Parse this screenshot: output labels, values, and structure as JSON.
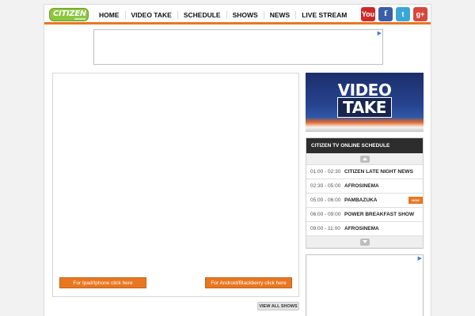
{
  "logo": {
    "text": "CITIZEN"
  },
  "nav": [
    "HOME",
    "VIDEO TAKE",
    "SCHEDULE",
    "SHOWS",
    "NEWS",
    "LIVE STREAM"
  ],
  "social": [
    {
      "name": "youtube-icon",
      "label": "You",
      "color": "#cc2a2a"
    },
    {
      "name": "facebook-icon",
      "label": "f",
      "color": "#3b5ea8"
    },
    {
      "name": "twitter-icon",
      "label": "t",
      "color": "#3ba6d8"
    },
    {
      "name": "google-plus-icon",
      "label": "g+",
      "color": "#d8473b"
    }
  ],
  "player": {
    "ios_button": "For Ipad/Iphone click here",
    "android_button": "For Android/Blackberry click here"
  },
  "view_all_shows": "VIEW ALL SHOWS",
  "video_take_banner": {
    "line1": "VIDEO",
    "line2": "TAKE"
  },
  "schedule": {
    "title": "CITIZEN TV ONLINE SCHEDULE",
    "rows": [
      {
        "time": "01:00 - 02:30",
        "show": "CITIZEN LATE NIGHT NEWS"
      },
      {
        "time": "02:30 - 05:00",
        "show": "AFROSINEMA"
      },
      {
        "time": "05:00 - 06:00",
        "show": "PAMBAZUKA",
        "now": true
      },
      {
        "time": "06:00 - 09:00",
        "show": "POWER BREAKFAST SHOW"
      },
      {
        "time": "09:00 - 11:00",
        "show": "AFROSINEMA"
      }
    ],
    "now_badge": "NOW"
  },
  "colors": {
    "accent": "#e87722",
    "brand_green": "#8cc63f",
    "schedule_header": "#2d2d2d"
  }
}
